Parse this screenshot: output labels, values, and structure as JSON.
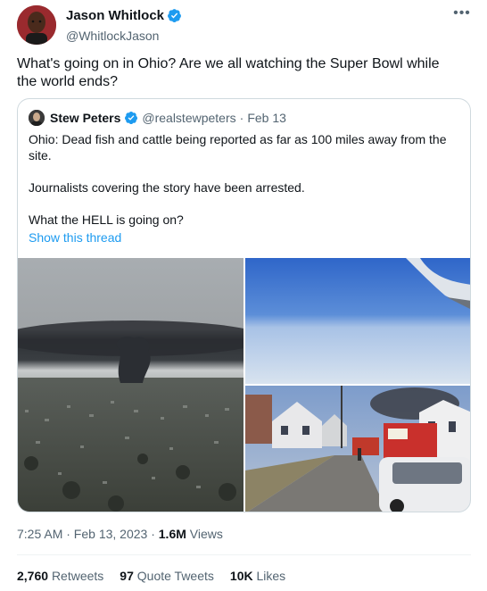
{
  "author": {
    "name": "Jason Whitlock",
    "handle": "@WhitlockJason"
  },
  "tweet_text": "What's going on in Ohio? Are we all watching the Super Bowl while the world ends?",
  "quote": {
    "name": "Stew Peters",
    "handle": "@realstewpeters",
    "separator": "·",
    "date": "Feb 13",
    "paragraphs": [
      "Ohio: Dead fish and cattle being reported as far as 100 miles away from the site.",
      "Journalists covering the story have been arrested.",
      "What the HELL is going on?"
    ],
    "show_thread": "Show this thread"
  },
  "meta": {
    "time_date": "7:25 AM · Feb 13, 2023 · ",
    "views_count": "1.6M",
    "views_label": " Views"
  },
  "stats": {
    "retweets_count": "2,760",
    "retweets_label": "Retweets",
    "quotes_count": "97",
    "quotes_label": "Quote Tweets",
    "likes_count": "10K",
    "likes_label": "Likes"
  },
  "colors": {
    "accent": "#1d9bf0",
    "secondary_text": "#536471",
    "border": "#cfd9de"
  },
  "icons": {
    "verified": "verified-badge-icon",
    "more": "more-options-icon"
  }
}
